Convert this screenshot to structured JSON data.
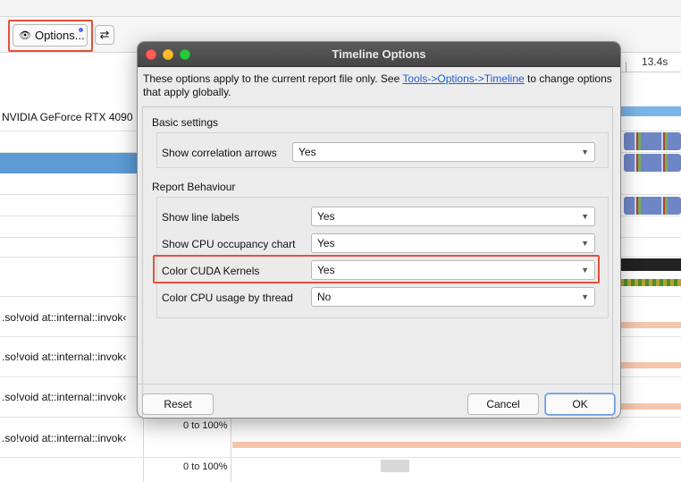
{
  "toolbar": {
    "options_label": "Options...",
    "swap_glyph": "⇄",
    "time_label": "13.4s"
  },
  "rows": {
    "gpu_label": "NVIDIA GeForce RTX 4090",
    "invoke_labels": [
      ".so!void at::internal::invok‹",
      ".so!void at::internal::invok‹",
      ".so!void at::internal::invok‹",
      ".so!void at::internal::invok‹"
    ],
    "pct_labels": [
      "0 to 100%",
      "0 to 100%"
    ]
  },
  "dialog": {
    "title": "Timeline Options",
    "info_text_before": "These options apply to the current report file only. See ",
    "info_link": "Tools->Options->Timeline",
    "info_text_after": " to change options that apply globally.",
    "basic_settings": {
      "heading": "Basic settings",
      "options": [
        {
          "label": "Show correlation arrows",
          "value": "Yes"
        }
      ]
    },
    "report_behaviour": {
      "heading": "Report Behaviour",
      "options": [
        {
          "label": "Show line labels",
          "value": "Yes"
        },
        {
          "label": "Show CPU occupancy chart",
          "value": "Yes"
        },
        {
          "label": "Color CUDA Kernels",
          "value": "Yes"
        },
        {
          "label": "Color CPU usage by thread",
          "value": "No"
        }
      ]
    },
    "buttons": {
      "reset": "Reset",
      "cancel": "Cancel",
      "ok": "OK"
    }
  },
  "colors": {
    "highlight": "#e4513a",
    "link": "#1a5fd6",
    "selected_row": "#5e9bd5"
  }
}
